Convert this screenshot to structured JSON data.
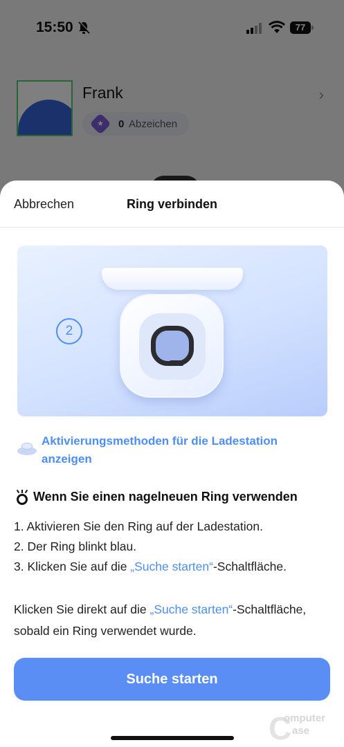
{
  "status_bar": {
    "time": "15:50",
    "mute_icon": "bell-slash-icon",
    "signal_icon": "cellular-signal-icon",
    "wifi_icon": "wifi-icon",
    "battery_level": "77"
  },
  "background": {
    "profile_name": "Frank",
    "badge_count": "0",
    "badge_label": "Abzeichen"
  },
  "sheet": {
    "cancel_label": "Abbrechen",
    "title": "Ring verbinden",
    "hero_step": "2",
    "activation_link": "Aktivierungsmethoden für die Ladestation anzeigen",
    "tip_heading": "Wenn Sie einen nagelneuen Ring verwenden",
    "steps": [
      {
        "text": "1. Aktivieren Sie den Ring auf der Ladestation."
      },
      {
        "text": "2. Der Ring blinkt blau."
      },
      {
        "prefix": "3. Klicken Sie auf die ",
        "quote": "„Suche starten“",
        "suffix": "-Schaltfläche."
      }
    ],
    "note": {
      "prefix": "Klicken Sie direkt auf die ",
      "quote": "„Suche starten“",
      "suffix": "-Schaltfläche, sobald ein Ring verwendet wurde."
    },
    "cta_label": "Suche starten"
  },
  "watermark": {
    "line1": "omputer",
    "line2": "ase"
  },
  "colors": {
    "accent": "#5a8ef5",
    "link": "#4d8ef5",
    "step_circle": "#4d8ef5"
  }
}
